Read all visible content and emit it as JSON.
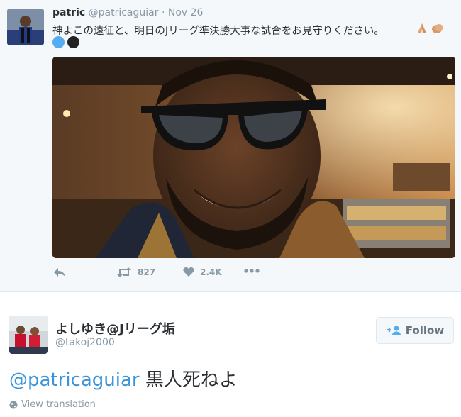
{
  "quoted_tweet": {
    "author_name": "patric",
    "author_handle": "@patricaguiar",
    "separator": "·",
    "timestamp": "Nov 26",
    "text": "神よこの遠征と、明日のJリーグ準決勝大事な試合をお見守りください。",
    "emojis": [
      "folded-hands",
      "clapping-hands",
      "blue-circle",
      "black-circle"
    ],
    "actions": {
      "reply_icon": "reply-icon",
      "retweet_count": "827",
      "like_count": "2.4K",
      "more_icon": "more-icon"
    }
  },
  "tweet": {
    "author_name": "よしゆき@Jリーグ垢",
    "author_handle": "@takoj2000",
    "follow_label": "Follow",
    "mention": "@patricaguiar",
    "text": " 黒人死ねよ",
    "translate_label": "View translation"
  },
  "colors": {
    "link": "#3b94d9",
    "muted": "#8899a6",
    "text": "#292f33",
    "quoted_bg": "#f5f8fa"
  }
}
